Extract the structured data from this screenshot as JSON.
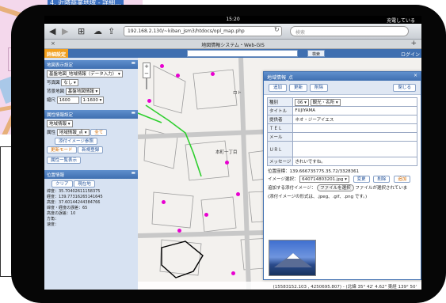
{
  "background": {
    "map_label": "4. 近隣商業地域 - 詳細..."
  },
  "device": {
    "status_time": "15:20",
    "status_charge": "充電している"
  },
  "browser": {
    "url": "192.168.2.130/~kiban_jsm3/htdocs/opl_map.php",
    "search_placeholder": "検索",
    "tab_title": "地図情報システム・Web-GIS",
    "tab_close": "×",
    "tab_add": "+",
    "icons": [
      "back-icon",
      "forward-icon",
      "bookmarks-icon",
      "cloud-icon",
      "share-icon",
      "reload-icon"
    ]
  },
  "app": {
    "detail_label": "詳細設定",
    "search_button": "検索",
    "login_label": "ログイン",
    "accent_color": "#3f6fb0",
    "highlight_color": "#f2a01e"
  },
  "left_panel": {
    "map_display": {
      "header": "地図表示設定",
      "base_map": "基盤地図_地域情報（データ入力）",
      "photo_label": "写真図",
      "photo_value": "なし",
      "bg_label": "背景地図",
      "bg_value": "基盤地図情報",
      "scale_label": "縮尺",
      "scale_value": "1600",
      "scale_select": "1:1600"
    },
    "attribute": {
      "header": "属性情報設定",
      "layer_value": "地域情報",
      "attr_label": "属性",
      "attr_value": "地域情報_点",
      "all_button": "全て",
      "add_attr_button": "添付イメージ参照",
      "update_mode_button": "更新モード",
      "new_register_button": "新規登録",
      "attr_list_button": "属性一覧表示"
    },
    "position": {
      "header": "位置情報",
      "clear_button": "クリア",
      "current_button": "現在地",
      "lines": [
        "緯度：35.70402611158375",
        "経度：139.77316265141645",
        "高度：37.60144244384766",
        "緯度・経度の誤差：65",
        "高度の誤差：10",
        "方角：",
        "速度："
      ]
    }
  },
  "map": {
    "label_town": "本町一丁目",
    "label_road": "ロト",
    "footer": "(15583152.103 , 4250695.807) - (北緯 35° 42' 4.62\" 東経 139° 50'"
  },
  "popup": {
    "title": "地域情報_点",
    "close_icon": "×",
    "buttons": {
      "add": "追加",
      "update": "更新",
      "delete": "削除",
      "close": "閉じる"
    },
    "fields": [
      {
        "key": "種別",
        "value": "06",
        "value2": "観光・名所"
      },
      {
        "key": "タイトル",
        "value": "FUJIYAMA"
      },
      {
        "key": "提供者",
        "value": "ネオ・ジーアイエス"
      },
      {
        "key": "ＴＥＬ",
        "value": ""
      },
      {
        "key": "メール",
        "value": ""
      },
      {
        "key": "ＵＲＬ",
        "value": ""
      },
      {
        "key": "メッセージ",
        "value": "きれいですね。"
      }
    ],
    "coords": "位置座標：139.666735775.35.72/3328361",
    "image_select_label": "イメージ選択：",
    "image_select_value": "640714803201.jpg",
    "change_button": "変更",
    "delete_button": "削除",
    "add_button": "追加",
    "attach_label": "追加する添付イメージ：",
    "file_button": "ファイルを選択",
    "file_status": "ファイルが選択されていま",
    "format_note": "(添付イメージの形式は、.jpeg、.gif、.png です。)"
  }
}
